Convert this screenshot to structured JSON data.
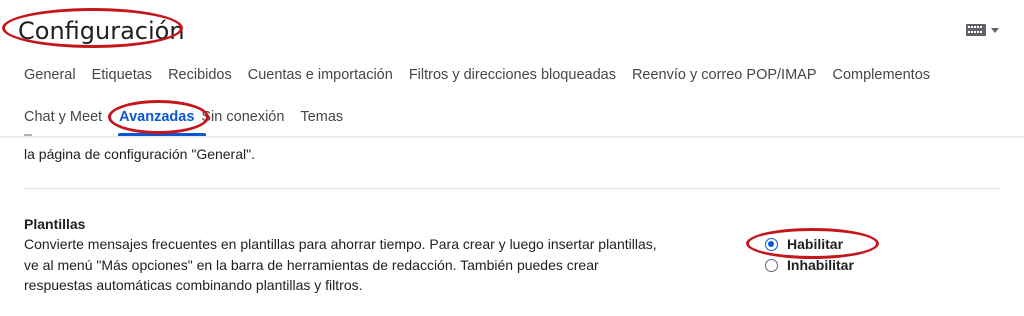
{
  "header": {
    "title": "Configuración"
  },
  "tabs": {
    "row1": [
      {
        "label": "General"
      },
      {
        "label": "Etiquetas"
      },
      {
        "label": "Recibidos"
      },
      {
        "label": "Cuentas e importación"
      },
      {
        "label": "Filtros y direcciones bloqueadas"
      },
      {
        "label": "Reenvío y correo POP/IMAP"
      },
      {
        "label": "Complementos"
      }
    ],
    "row2": [
      {
        "label": "Chat y Meet"
      },
      {
        "label": "Avanzadas"
      },
      {
        "label": "Sin conexión"
      },
      {
        "label": "Temas"
      }
    ],
    "active": "Avanzadas"
  },
  "content": {
    "previous_line": "la página de configuración \"General\".",
    "templates": {
      "title": "Plantillas",
      "description": "Convierte mensajes frecuentes en plantillas para ahorrar tiempo. Para crear y luego insertar plantillas, ve al menú \"Más opciones\" en la barra de herramientas de redacción. También puedes crear respuestas automáticas combinando plantillas y filtros.",
      "options": [
        {
          "label": "Habilitar",
          "checked": true
        },
        {
          "label": "Inhabilitar",
          "checked": false
        }
      ]
    }
  },
  "colors": {
    "accent": "#0b57d0",
    "annotation": "#c5161d"
  },
  "icons": {
    "keyboard": "keyboard-icon",
    "dropdown": "chevron-down-icon"
  }
}
